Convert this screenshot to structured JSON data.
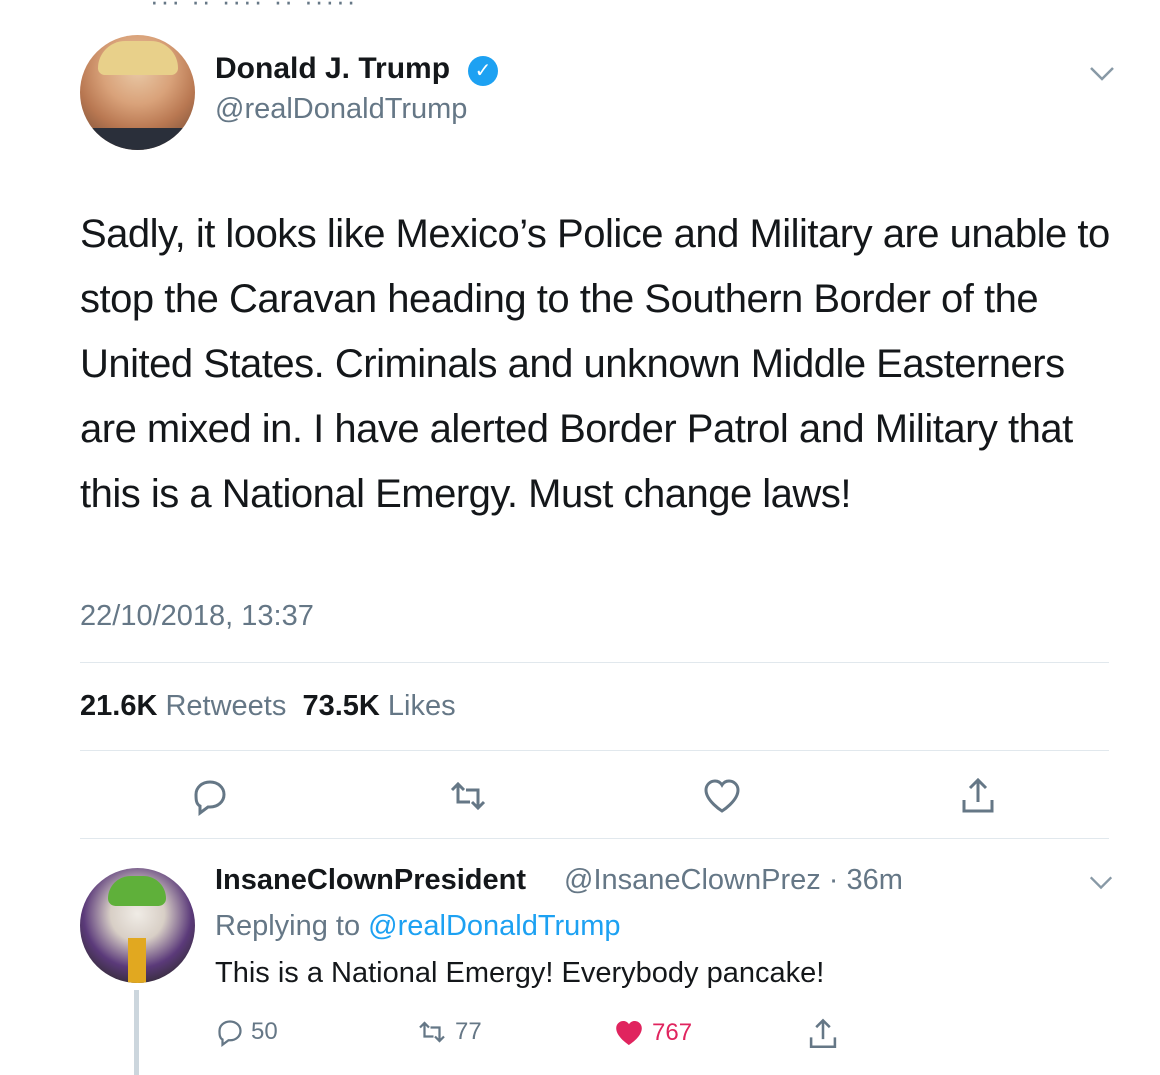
{
  "tweet": {
    "author_name": "Donald J. Trump",
    "author_handle": "@realDonaldTrump",
    "text": "Sadly, it looks like Mexico’s Police and Military are unable to stop the Caravan heading to the Southern Border of the United States. Criminals and unknown Middle Easterners are mixed in. I have alerted Border Patrol and Military that this is a National Emergy. Must change laws!",
    "timestamp": "22/10/2018, 13:37",
    "retweet_count": "21.6K",
    "retweet_label": "Retweets",
    "like_count": "73.5K",
    "like_label": "Likes"
  },
  "reply": {
    "author_name": "InsaneClownPresident",
    "author_handle_time": "@InsaneClownPrez · 36m",
    "replying_prefix": "Replying to",
    "replying_mention": "@realDonaldTrump",
    "text": "This is a National Emergy! Everybody pancake!",
    "reply_count": "50",
    "retweet_count": "77",
    "like_count": "767"
  },
  "colors": {
    "accent": "#1da1f2",
    "muted": "#657786",
    "like": "#e0245e",
    "divider": "#e1e8ed"
  },
  "icons": [
    "verified-badge-icon",
    "chevron-down-icon",
    "reply-icon",
    "retweet-icon",
    "like-icon",
    "share-icon"
  ]
}
